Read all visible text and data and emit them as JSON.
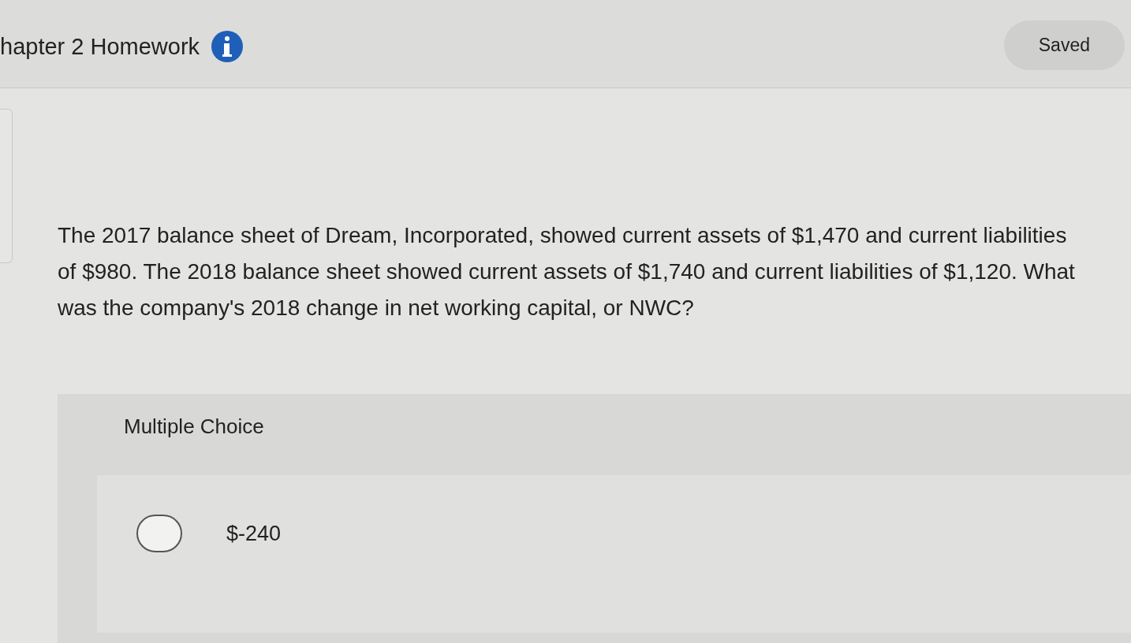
{
  "header": {
    "title": "hapter 2 Homework",
    "status": "Saved"
  },
  "question": {
    "text": "The 2017 balance sheet of Dream, Incorporated, showed current assets of $1,470 and current liabilities of $980. The 2018 balance sheet showed current assets of $1,740 and current liabilities of $1,120. What was the company's 2018 change in net working capital, or NWC?"
  },
  "multiple_choice": {
    "label": "Multiple Choice",
    "options": [
      {
        "label": "$-240",
        "selected": false
      }
    ]
  }
}
